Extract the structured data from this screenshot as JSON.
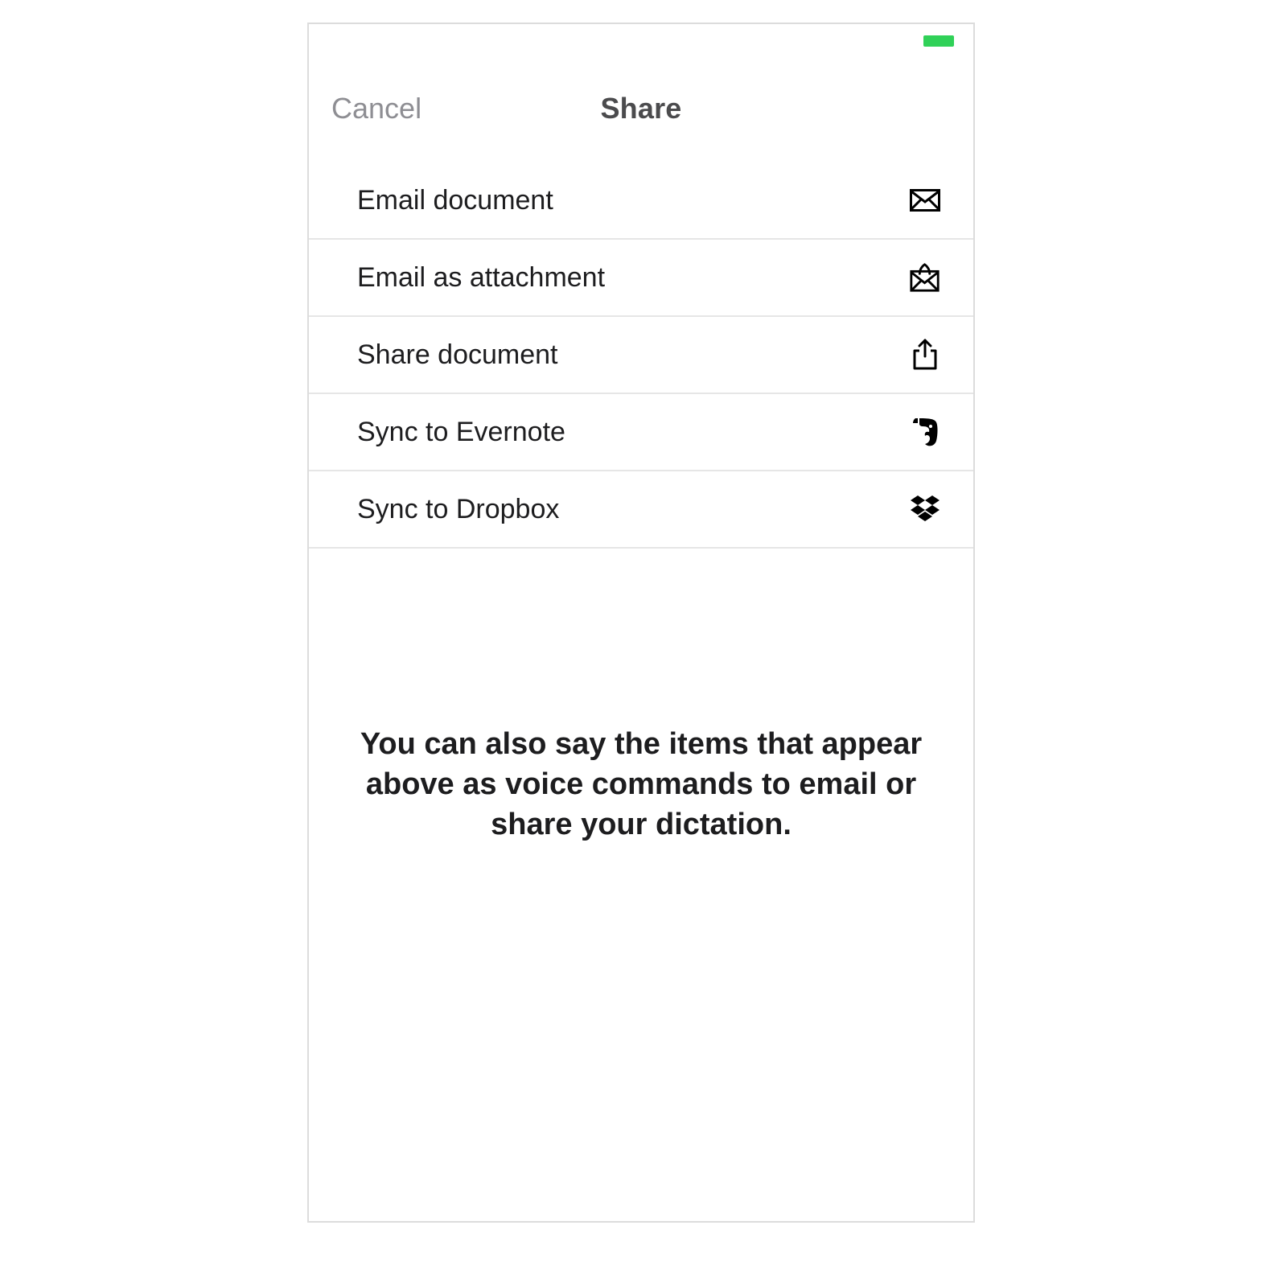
{
  "navbar": {
    "cancel_label": "Cancel",
    "title": "Share"
  },
  "options": [
    {
      "label": "Email document",
      "icon": "mail-icon"
    },
    {
      "label": "Email as attachment",
      "icon": "mail-attachment-icon"
    },
    {
      "label": "Share document",
      "icon": "share-icon"
    },
    {
      "label": "Sync to Evernote",
      "icon": "evernote-icon"
    },
    {
      "label": "Sync to Dropbox",
      "icon": "dropbox-icon"
    }
  ],
  "hint_text": "You can also say the items that appear above as voice commands to email or share your dictation."
}
